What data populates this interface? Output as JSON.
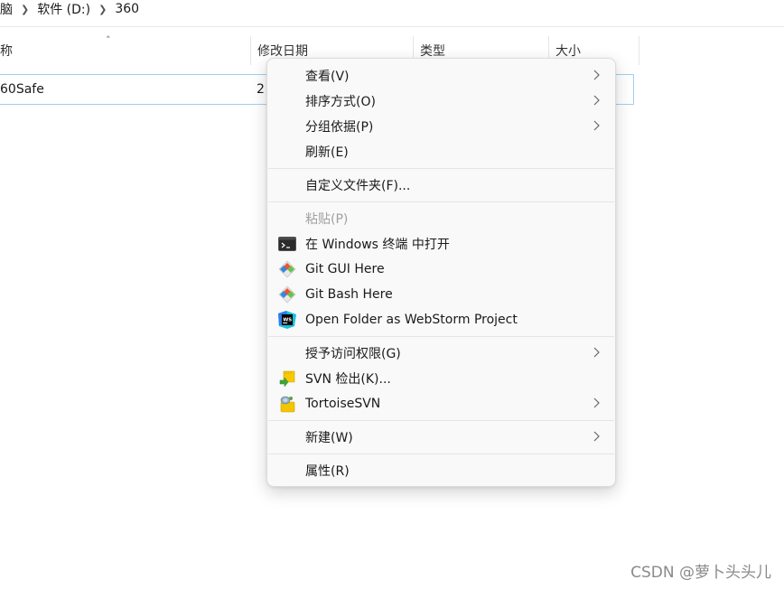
{
  "breadcrumb": {
    "items": [
      "脑",
      "软件 (D:)",
      "360"
    ]
  },
  "columns": {
    "name": "称",
    "modified": "修改日期",
    "type": "类型",
    "size": "大小"
  },
  "row": {
    "name": "60Safe",
    "modified": "2"
  },
  "menu": {
    "items": [
      {
        "label": "查看(V)",
        "submenu": true
      },
      {
        "label": "排序方式(O)",
        "submenu": true
      },
      {
        "label": "分组依据(P)",
        "submenu": true
      },
      {
        "label": "刷新(E)",
        "submenu": false
      },
      {
        "label": "自定义文件夹(F)...",
        "submenu": false
      },
      {
        "label": "粘贴(P)",
        "submenu": false,
        "disabled": true
      },
      {
        "label": "在 Windows 终端 中打开",
        "icon": "terminal-icon"
      },
      {
        "label": "Git GUI Here",
        "icon": "git-icon"
      },
      {
        "label": "Git Bash Here",
        "icon": "git-icon"
      },
      {
        "label": "Open Folder as WebStorm Project",
        "icon": "webstorm-icon"
      },
      {
        "label": "授予访问权限(G)",
        "submenu": true
      },
      {
        "label": "SVN 检出(K)...",
        "icon": "svn-checkout-icon"
      },
      {
        "label": "TortoiseSVN",
        "icon": "tortoisesvn-icon",
        "submenu": true
      },
      {
        "label": "新建(W)",
        "submenu": true
      },
      {
        "label": "属性(R)",
        "submenu": false
      }
    ]
  },
  "watermark": "CSDN @萝卜头头儿",
  "colors": {
    "selection_border": "#9fd0ee",
    "menu_bg": "#f9f9f9",
    "disabled_text": "#a0a0a0"
  }
}
